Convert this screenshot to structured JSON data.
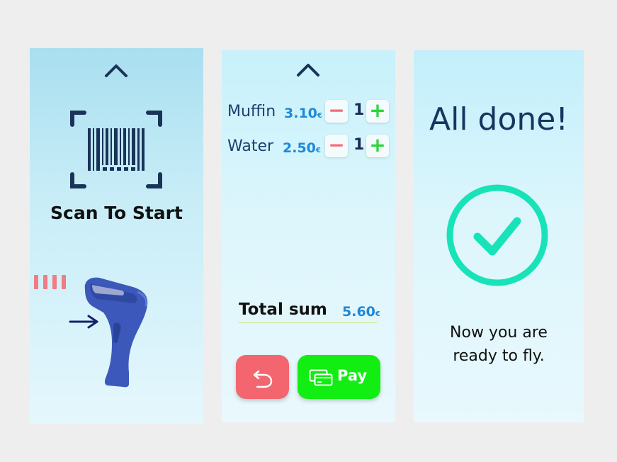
{
  "colors": {
    "accent_blue": "#1e88d6",
    "navy": "#1d3f6e",
    "minus_red": "#f26d79",
    "plus_green": "#2bd63a",
    "pay_green": "#12ee12",
    "back_red": "#f3666f",
    "check_teal": "#18e3b8"
  },
  "scan_screen": {
    "chevron_icon": "chevron-up-icon",
    "title": "Scan To Start",
    "icons": [
      "barcode-icon",
      "scanner-icon",
      "arrow-right-icon"
    ]
  },
  "cart_screen": {
    "chevron_icon": "chevron-up-icon",
    "items": [
      {
        "name": "Muffin",
        "price": "3.10",
        "currency": "€",
        "minus": "−",
        "qty": "1",
        "plus": "+"
      },
      {
        "name": "Water",
        "price": "2.50",
        "currency": "€",
        "minus": "−",
        "qty": "1",
        "plus": "+"
      }
    ],
    "total_label": "Total sum",
    "total_value": "5.60",
    "total_currency": "€",
    "back_icon": "undo-icon",
    "pay_label": "Pay",
    "pay_icon": "credit-card-icon"
  },
  "done_screen": {
    "title": "All done!",
    "message_line1": "Now you are",
    "message_line2": "ready to fly.",
    "check_icon": "check-circle-icon"
  }
}
